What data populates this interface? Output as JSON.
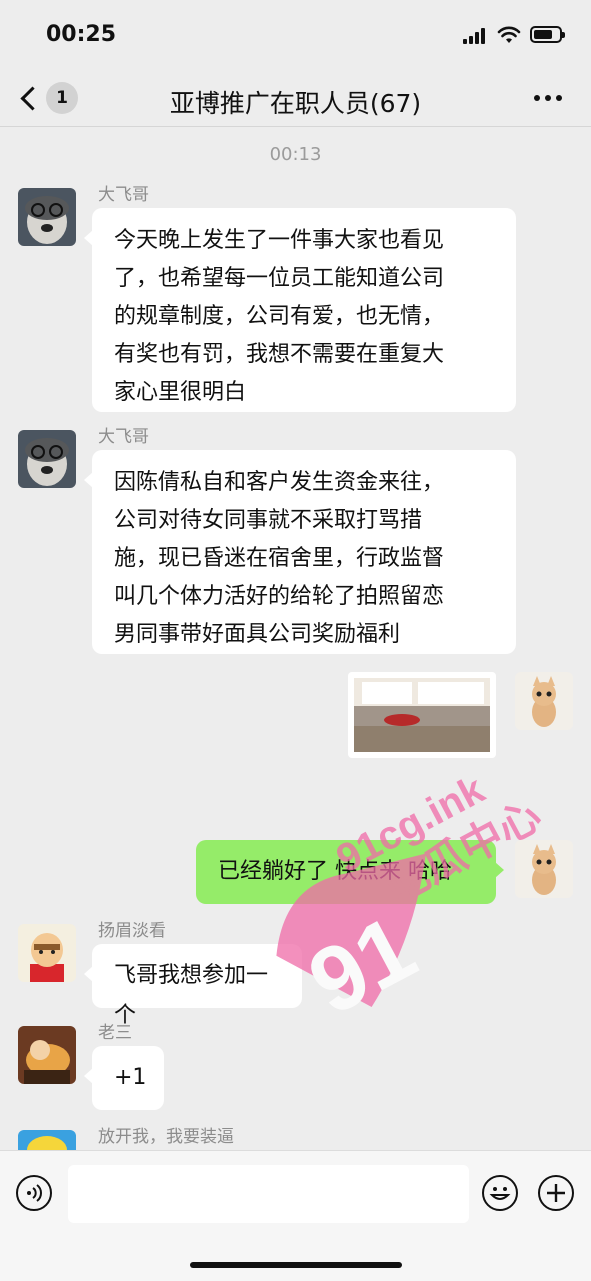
{
  "status": {
    "time": "00:25"
  },
  "header": {
    "back_badge": "1",
    "title": "亚博推广在职人员(67)"
  },
  "timestamp": "00:13",
  "messages": [
    {
      "sender": "大飞哥",
      "text": "今天晚上发生了一件事大家也看见\n了，也希望每一位员工能知道公司\n的规章制度，公司有爱，也无情，\n有奖也有罚，我想不需要在重复大\n家心里很明白"
    },
    {
      "sender": "大飞哥",
      "text": "因陈倩私自和客户发生资金来往，\n公司对待女同事就不采取打骂措\n施，现已昏迷在宿舍里，行政监督\n叫几个体力活好的给轮了拍照留恋\n男同事带好面具公司奖励福利"
    },
    {
      "sender": "",
      "type": "image"
    },
    {
      "sender": "",
      "text": "已经躺好了 快点来 哈哈"
    },
    {
      "sender": "扬眉淡看",
      "text": "飞哥我想参加一个"
    },
    {
      "sender": "老三",
      "text": "+1"
    },
    {
      "sender": "放开我，我要装逼",
      "text": ""
    }
  ],
  "watermark": {
    "number": "91",
    "site": "91cg.ink",
    "name": "吃瓜中心"
  },
  "colors": {
    "accent_green": "#95ec69",
    "background": "#ededed",
    "watermark_pink": "#f06ba8"
  }
}
